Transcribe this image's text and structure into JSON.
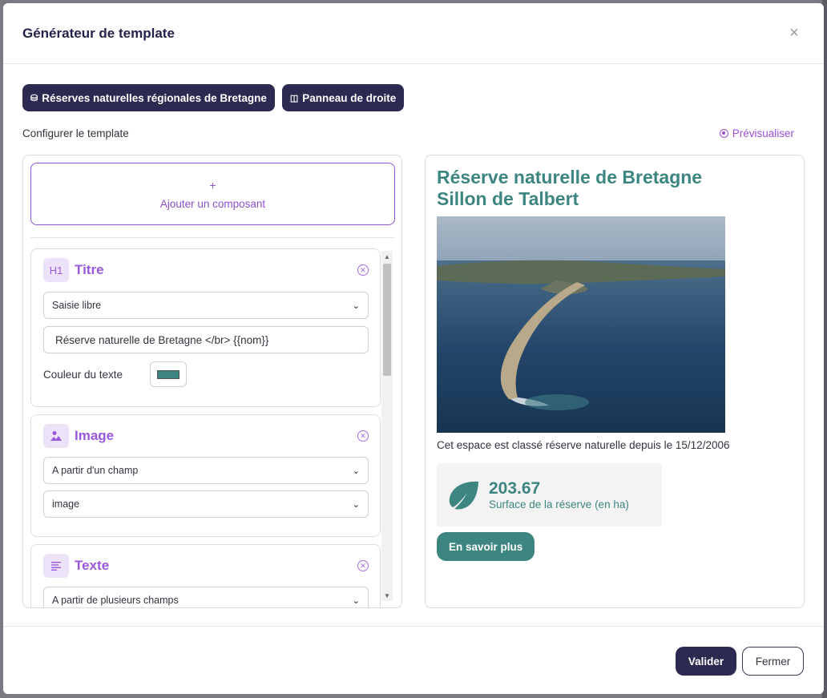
{
  "modal": {
    "title": "Générateur de template",
    "close_icon": "close-icon"
  },
  "chips": [
    {
      "icon": "database-icon",
      "label": "Réserves naturelles régionales de Bretagne"
    },
    {
      "icon": "panel-icon",
      "label": "Panneau de droite"
    }
  ],
  "config_label": "Configurer le template",
  "preview_link": {
    "icon": "preview-radio-icon",
    "label": "Prévisualiser"
  },
  "add_component": {
    "plus": "+",
    "label": "Ajouter un composant"
  },
  "components": [
    {
      "icon_text": "H1",
      "title": "Titre",
      "mode": "Saisie libre",
      "value": "Réserve naturelle de Bretagne </br> {{nom}}",
      "color_label": "Couleur du texte",
      "color": "#3d8580"
    },
    {
      "icon": "image-icon",
      "title": "Image",
      "mode": "A partir d'un champ",
      "field": "image"
    },
    {
      "icon": "text-lines-icon",
      "title": "Texte",
      "mode": "A partir de plusieurs champs"
    }
  ],
  "preview": {
    "title_line1": "Réserve naturelle de Bretagne",
    "title_line2": "Sillon de Talbert",
    "caption": "Cet espace est classé réserve naturelle depuis le 15/12/2006",
    "stat_value": "203.67",
    "stat_label": "Surface de la réserve (en ha)",
    "stat_icon": "leaf-icon",
    "button_label": "En savoir plus",
    "accent": "#3d8580"
  },
  "footer": {
    "validate_label": "Valider",
    "close_label": "Fermer"
  },
  "colors": {
    "primary": "#2d2a52",
    "purple": "#9a57dc",
    "teal": "#3d8580"
  }
}
